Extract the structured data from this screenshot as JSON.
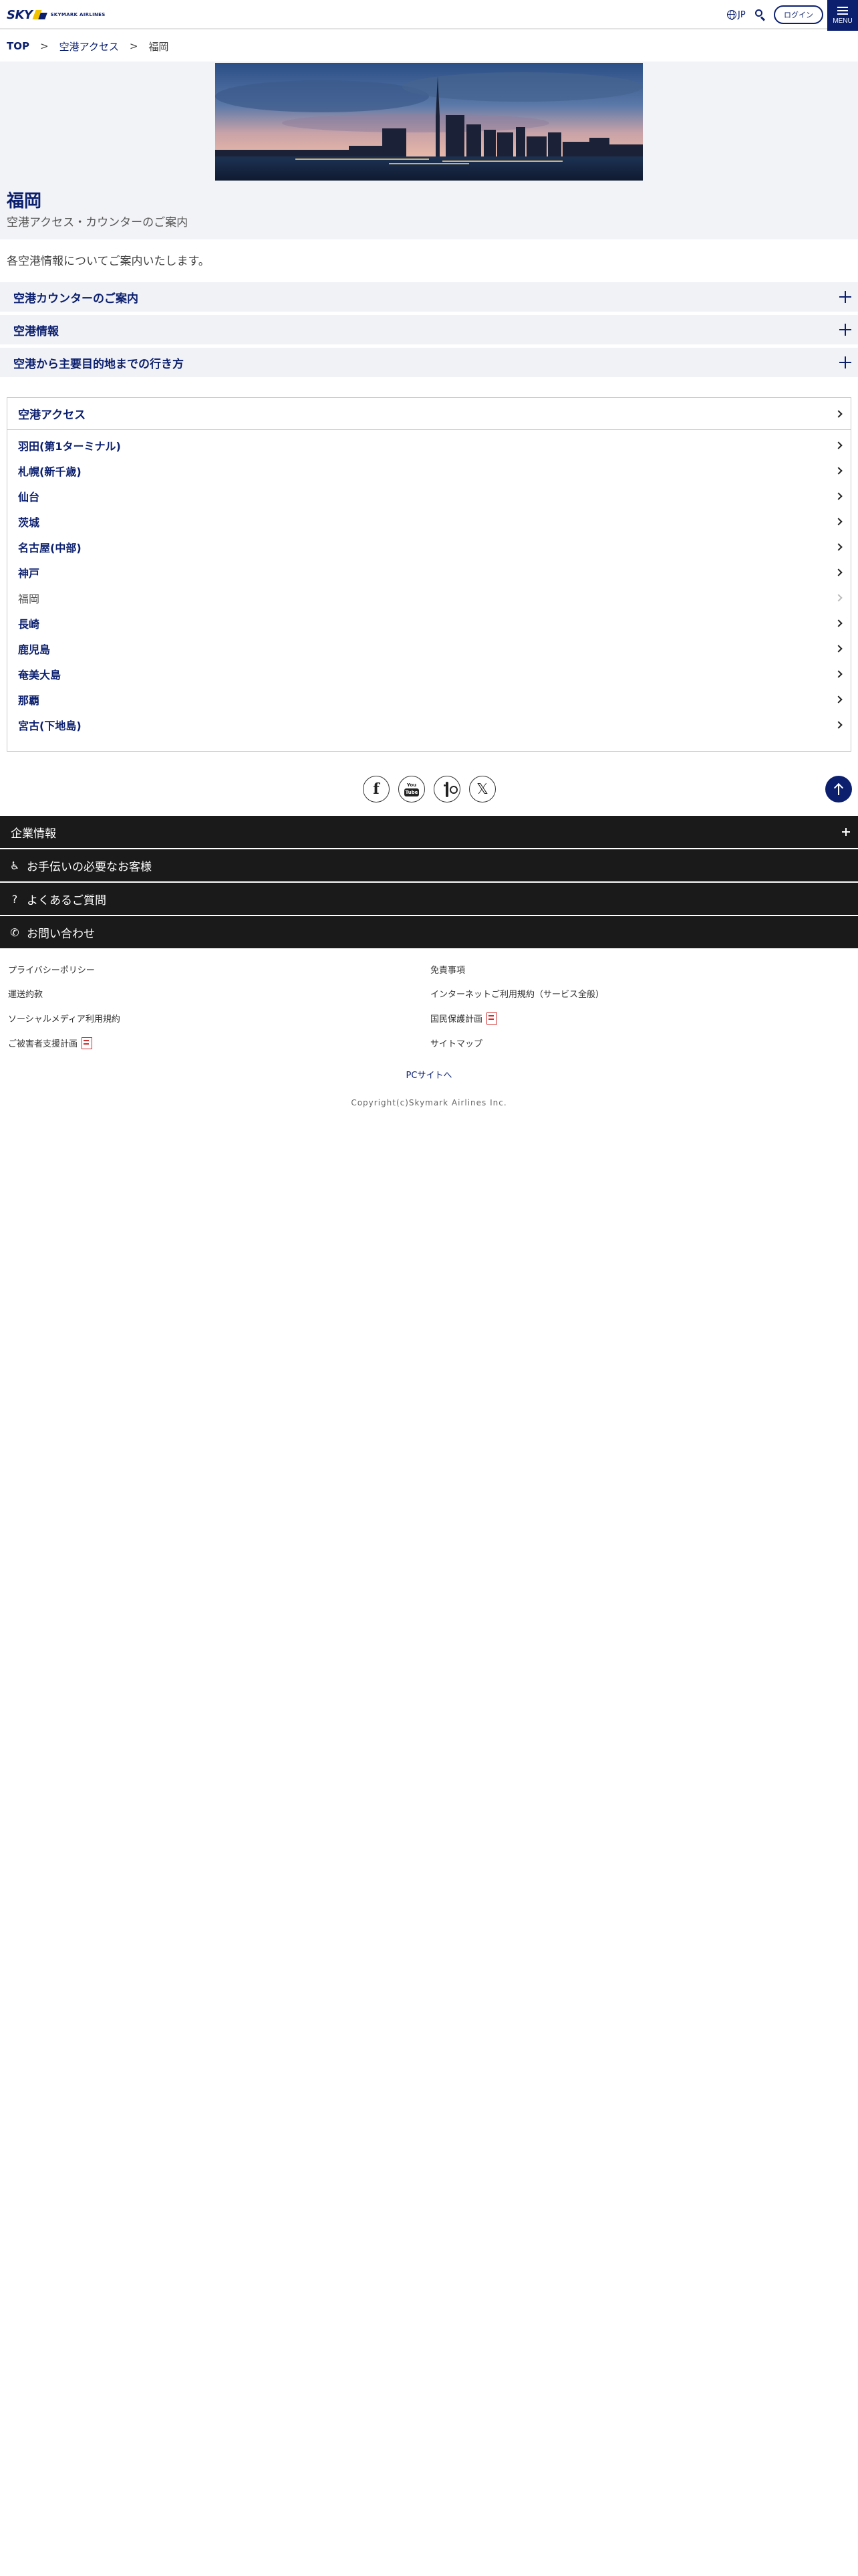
{
  "header": {
    "logo_text": "SKY",
    "logo_sub": "SKYMARK AIRLINES",
    "lang": "JP",
    "login_label": "ログイン",
    "menu_label": "MENU"
  },
  "breadcrumb": {
    "top": "TOP",
    "sep": ">",
    "level1": "空港アクセス",
    "current": "福岡"
  },
  "page": {
    "title": "福岡",
    "subtitle": "空港アクセス・カウンターのご案内",
    "intro": "各空港情報についてご案内いたします。"
  },
  "accordions": [
    {
      "label": "空港カウンターのご案内"
    },
    {
      "label": "空港情報"
    },
    {
      "label": "空港から主要目的地までの行き方"
    }
  ],
  "airport_box": {
    "heading": "空港アクセス",
    "items": [
      {
        "label": "羽田(第1ターミナル)"
      },
      {
        "label": "札幌(新千歳)"
      },
      {
        "label": "仙台"
      },
      {
        "label": "茨城"
      },
      {
        "label": "名古屋(中部)"
      },
      {
        "label": "神戸"
      },
      {
        "label": "福岡"
      },
      {
        "label": "長崎"
      },
      {
        "label": "鹿児島"
      },
      {
        "label": "奄美大島"
      },
      {
        "label": "那覇"
      },
      {
        "label": "宮古(下地島)"
      }
    ],
    "current_index": 6
  },
  "social": {
    "icons": [
      "facebook-icon",
      "youtube-icon",
      "instagram-icon",
      "x-icon"
    ],
    "youtube_top": "You",
    "youtube_box": "Tube"
  },
  "footer": {
    "rows": [
      {
        "label": "企業情報"
      },
      {
        "label": "お手伝いの必要なお客様"
      },
      {
        "label": "よくあるご質問"
      },
      {
        "label": "お問い合わせ"
      }
    ],
    "links_left": [
      {
        "label": "プライバシーポリシー",
        "pdf": false
      },
      {
        "label": "運送約款",
        "pdf": false
      },
      {
        "label": "ソーシャルメディア利用規約",
        "pdf": false
      },
      {
        "label": "ご被害者支援計画",
        "pdf": true
      }
    ],
    "links_right": [
      {
        "label": "免責事項",
        "pdf": false
      },
      {
        "label": "インターネットご利用規約（サービス全般）",
        "pdf": false
      },
      {
        "label": "国民保護計画",
        "pdf": true
      },
      {
        "label": "サイトマップ",
        "pdf": false
      }
    ],
    "pc_site": "PCサイトへ",
    "copyright": "Copyright(c)Skymark Airlines Inc."
  },
  "colors": {
    "brand_navy": "#0b1f6e",
    "accordion_bg": "#f1f2f6",
    "footer_dark": "#1a1a1a"
  }
}
